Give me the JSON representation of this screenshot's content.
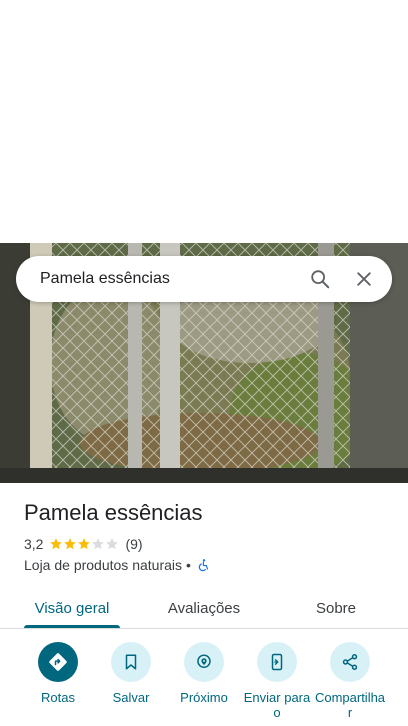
{
  "search": {
    "query": "Pamela essências"
  },
  "place": {
    "name": "Pamela essências",
    "rating": "3,2",
    "stars": 3,
    "review_count": "(9)",
    "category": "Loja de produtos naturais",
    "separator": "•"
  },
  "tabs": [
    {
      "label": "Visão geral",
      "active": true
    },
    {
      "label": "Avaliações",
      "active": false
    },
    {
      "label": "Sobre",
      "active": false
    }
  ],
  "actions": [
    {
      "label": "Rotas",
      "icon": "directions-icon"
    },
    {
      "label": "Salvar",
      "icon": "bookmark-icon"
    },
    {
      "label": "Próximo",
      "icon": "nearby-icon"
    },
    {
      "label": "Enviar para o",
      "icon": "send-to-phone-icon"
    },
    {
      "label": "Compartilhar",
      "icon": "share-icon"
    }
  ],
  "colors": {
    "accent": "#00677f",
    "accent_light": "#d7f1f7",
    "star": "#fbbc04"
  }
}
